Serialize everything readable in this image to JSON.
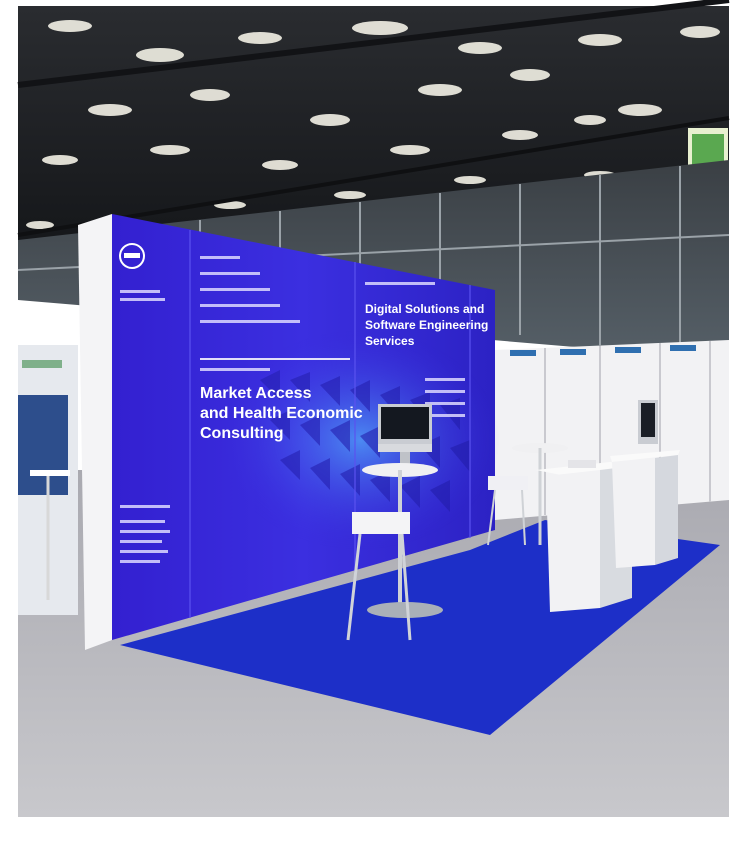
{
  "photo": {
    "booth_wall": {
      "headline_1_line_1": "Market Access",
      "headline_1_line_2": "and Health Economic",
      "headline_1_line_3": "Consulting",
      "headline_2_line_1": "Digital Solutions and",
      "headline_2_line_2": "Software Engineering",
      "headline_2_line_3": "Services"
    },
    "colors": {
      "backwall_blue": "#3a2bd8",
      "carpet_blue": "#1a2fd0",
      "floor_grey": "#b9b9be",
      "ceiling_dark": "#1e2024"
    }
  }
}
